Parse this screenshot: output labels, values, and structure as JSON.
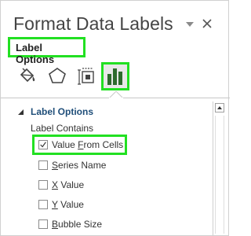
{
  "pane": {
    "title": "Format Data Labels"
  },
  "tabs": {
    "active_label": "Label Options"
  },
  "icons": [
    "fill-line-icon",
    "effects-icon",
    "size-properties-icon",
    "label-options-chart-icon"
  ],
  "section": {
    "header": "Label Options",
    "subheader": "Label Contains"
  },
  "options": [
    {
      "label": "Value From Cells",
      "checked": true
    },
    {
      "label": "Series Name",
      "checked": false
    },
    {
      "label": "X Value",
      "checked": false
    },
    {
      "label": "Y Value",
      "checked": false
    },
    {
      "label": "Bubble Size",
      "checked": false
    }
  ],
  "colors": {
    "highlight": "#22e022",
    "section_header": "#1f4e79"
  }
}
